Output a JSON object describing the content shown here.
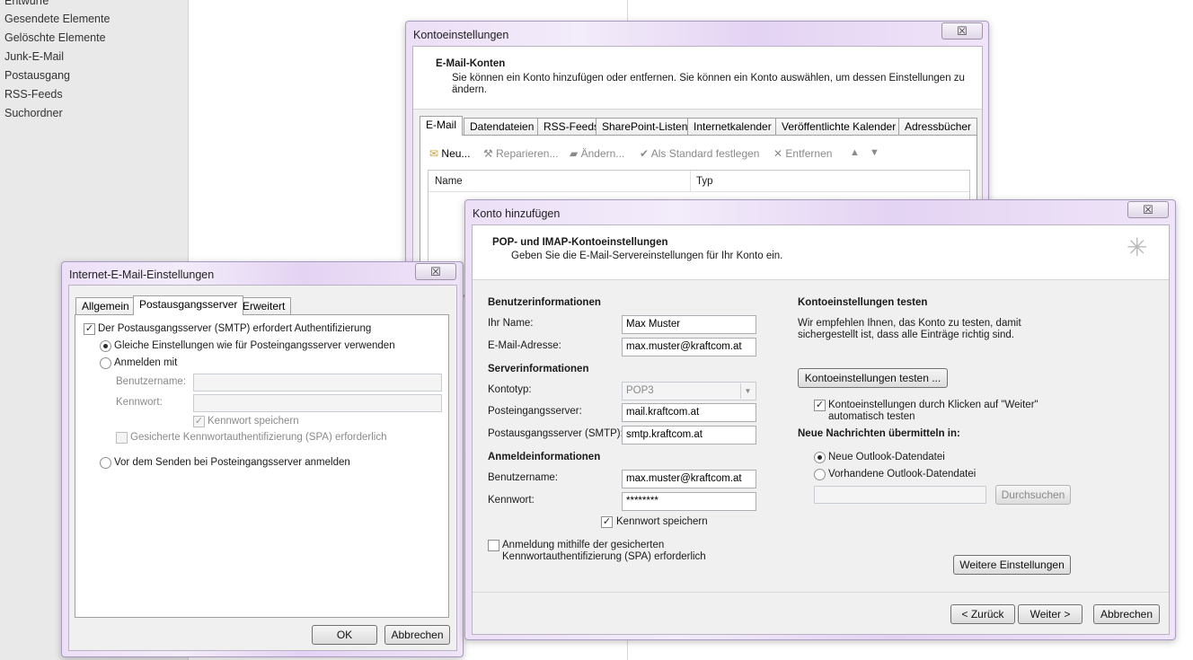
{
  "sidebar": {
    "items": [
      "Entwürfe",
      "Gesendete Elemente",
      "Gelöschte Elemente",
      "Junk-E-Mail",
      "Postausgang",
      "RSS-Feeds",
      "Suchordner"
    ]
  },
  "konto": {
    "title": "Kontoeinstellungen",
    "close": "☒",
    "heading": "E-Mail-Konten",
    "desc_line1": "Sie können ein Konto hinzufügen oder entfernen. Sie können ein Konto auswählen, um dessen Einstellungen zu",
    "desc_line2": "ändern.",
    "tabs": [
      "E-Mail",
      "Datendateien",
      "RSS-Feeds",
      "SharePoint-Listen",
      "Internetkalender",
      "Veröffentlichte Kalender",
      "Adressbücher"
    ],
    "toolbar": {
      "new": "Neu...",
      "repair": "Reparieren...",
      "change": "Ändern...",
      "default": "Als Standard festlegen",
      "remove": "Entfernen"
    },
    "columns": {
      "name": "Name",
      "type": "Typ"
    }
  },
  "add": {
    "title": "Konto hinzufügen",
    "close": "☒",
    "heading": "POP- und IMAP-Kontoeinstellungen",
    "subheading": "Geben Sie die E-Mail-Servereinstellungen für Ihr Konto ein.",
    "user_section": "Benutzerinformationen",
    "name_label": "Ihr Name:",
    "name_value": "Max Muster",
    "email_label": "E-Mail-Adresse:",
    "email_value": "max.muster@kraftcom.at",
    "server_section": "Serverinformationen",
    "type_label": "Kontotyp:",
    "type_value": "POP3",
    "incoming_label": "Posteingangsserver:",
    "incoming_value": "mail.kraftcom.at",
    "outgoing_label": "Postausgangsserver (SMTP):",
    "outgoing_value": "smtp.kraftcom.at",
    "login_section": "Anmeldeinformationen",
    "user_label": "Benutzername:",
    "user_value": "max.muster@kraftcom.at",
    "pw_label": "Kennwort:",
    "pw_value": "********",
    "save_pw": "Kennwort speichern",
    "spa_line1": "Anmeldung mithilfe der gesicherten",
    "spa_line2": "Kennwortauthentifizierung (SPA) erforderlich",
    "test_section": "Kontoeinstellungen testen",
    "test_desc1": "Wir empfehlen Ihnen, das Konto zu testen, damit",
    "test_desc2": "sichergestellt ist, dass alle Einträge richtig sind.",
    "test_button": "Kontoeinstellungen testen ...",
    "auto_test1": "Kontoeinstellungen durch Klicken auf \"Weiter\"",
    "auto_test2": "automatisch testen",
    "deliver_section": "Neue Nachrichten übermitteln in:",
    "new_file": "Neue Outlook-Datendatei",
    "existing_file": "Vorhandene Outlook-Datendatei",
    "browse": "Durchsuchen",
    "more_settings": "Weitere Einstellungen",
    "back": "< Zurück",
    "next": "Weiter >",
    "cancel": "Abbrechen"
  },
  "inet": {
    "title": "Internet-E-Mail-Einstellungen",
    "close": "☒",
    "tabs": [
      "Allgemein",
      "Postausgangsserver",
      "Erweitert"
    ],
    "smtp_auth": "Der Postausgangsserver (SMTP) erfordert Authentifizierung",
    "same_settings": "Gleiche Einstellungen wie für Posteingangsserver verwenden",
    "login_with": "Anmelden mit",
    "user_label": "Benutzername:",
    "pw_label": "Kennwort:",
    "save_pw": "Kennwort speichern",
    "spa": "Gesicherte Kennwortauthentifizierung (SPA) erforderlich",
    "before_send": "Vor dem Senden bei Posteingangsserver anmelden",
    "ok": "OK",
    "cancel": "Abbrechen"
  }
}
